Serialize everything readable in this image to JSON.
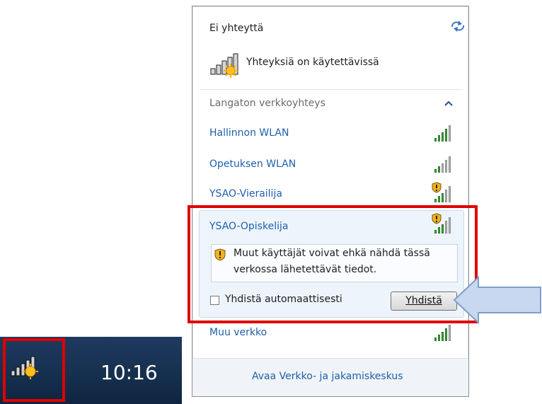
{
  "popup": {
    "status_title": "Ei yhteyttä",
    "status_subtitle": "Yhteyksiä on käytettävissä",
    "section_title": "Langaton verkkoyhteys",
    "networks": [
      {
        "name": "Hallinnon WLAN",
        "signal_bars": 4,
        "secured": false
      },
      {
        "name": "Opetuksen WLAN",
        "signal_bars": 2,
        "secured": false
      },
      {
        "name": "YSAO-Vierailija",
        "signal_bars": 3,
        "secured": true
      },
      {
        "name": "YSAO-Opiskelija",
        "signal_bars": 3,
        "secured": true
      }
    ],
    "selected_network": {
      "name": "YSAO-Opiskelija",
      "warning_line1": "Muut käyttäjät voivat ehkä nähdä tässä",
      "warning_line2": "verkossa lähetettävät tiedot.",
      "auto_connect_label": "Yhdistä automaattisesti",
      "auto_connect_checked": false,
      "connect_button_label": "Yhdistä"
    },
    "other_network": {
      "name": "Muu verkko",
      "signal_bars": 4
    },
    "footer_link": "Avaa Verkko- ja jakamiskeskus"
  },
  "taskbar": {
    "clock": "10:16"
  },
  "colors": {
    "link": "#1e5faa",
    "highlight_border": "#e00000",
    "arrow_fill": "#c8d8f0",
    "arrow_stroke": "#7f9fc8",
    "taskbar": "#16304f"
  },
  "icons": {
    "refresh": "refresh-icon",
    "network_status": "network-unavailable-icon",
    "collapse": "chevron-up-icon",
    "shield": "security-shield-icon",
    "pointer": "callout-arrow-icon"
  }
}
